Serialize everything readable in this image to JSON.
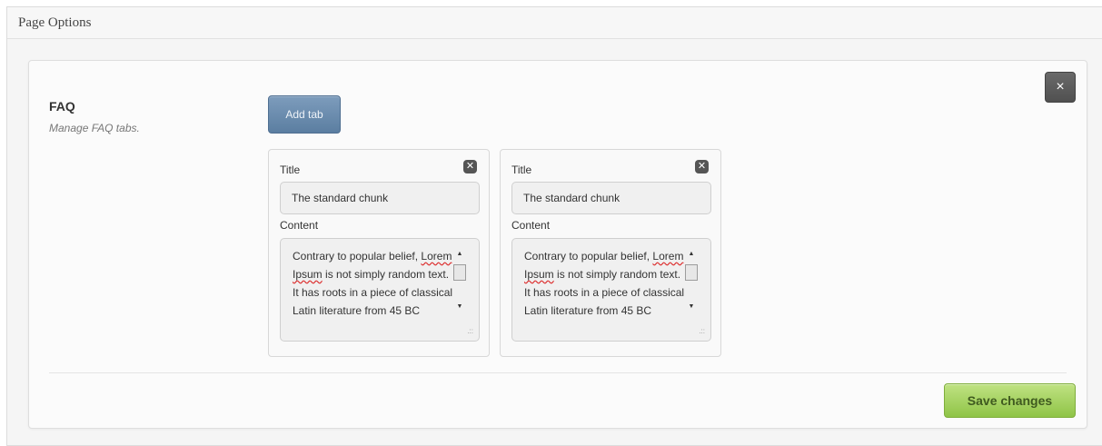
{
  "header": {
    "title": "Page Options"
  },
  "panel": {
    "close_label": "×",
    "section": {
      "title": "FAQ",
      "description": "Manage FAQ tabs."
    },
    "add_tab_label": "Add tab",
    "tabs": [
      {
        "remove_label": "✕",
        "title_label": "Title",
        "title_value": "The standard chunk",
        "content_label": "Content",
        "content_value": "Contrary to popular belief, Lorem Ipsum is not simply random text. It has roots in a piece of classical Latin literature from 45 BC"
      },
      {
        "remove_label": "✕",
        "title_label": "Title",
        "title_value": "The standard chunk",
        "content_label": "Content",
        "content_value": "Contrary to popular belief, Lorem Ipsum is not simply random text. It has roots in a piece of classical Latin literature from 45 BC"
      }
    ],
    "save_label": "Save changes"
  },
  "icons": {
    "close_panel": "close-icon",
    "remove_tab": "close-icon",
    "scroll_up": "arrow-up-icon",
    "scroll_down": "arrow-down-icon",
    "resize": "resize-grip-icon"
  },
  "colors": {
    "add_tab_button": "#6a8bad",
    "save_button": "#a6d464",
    "close_button": "#5e5e5e"
  }
}
